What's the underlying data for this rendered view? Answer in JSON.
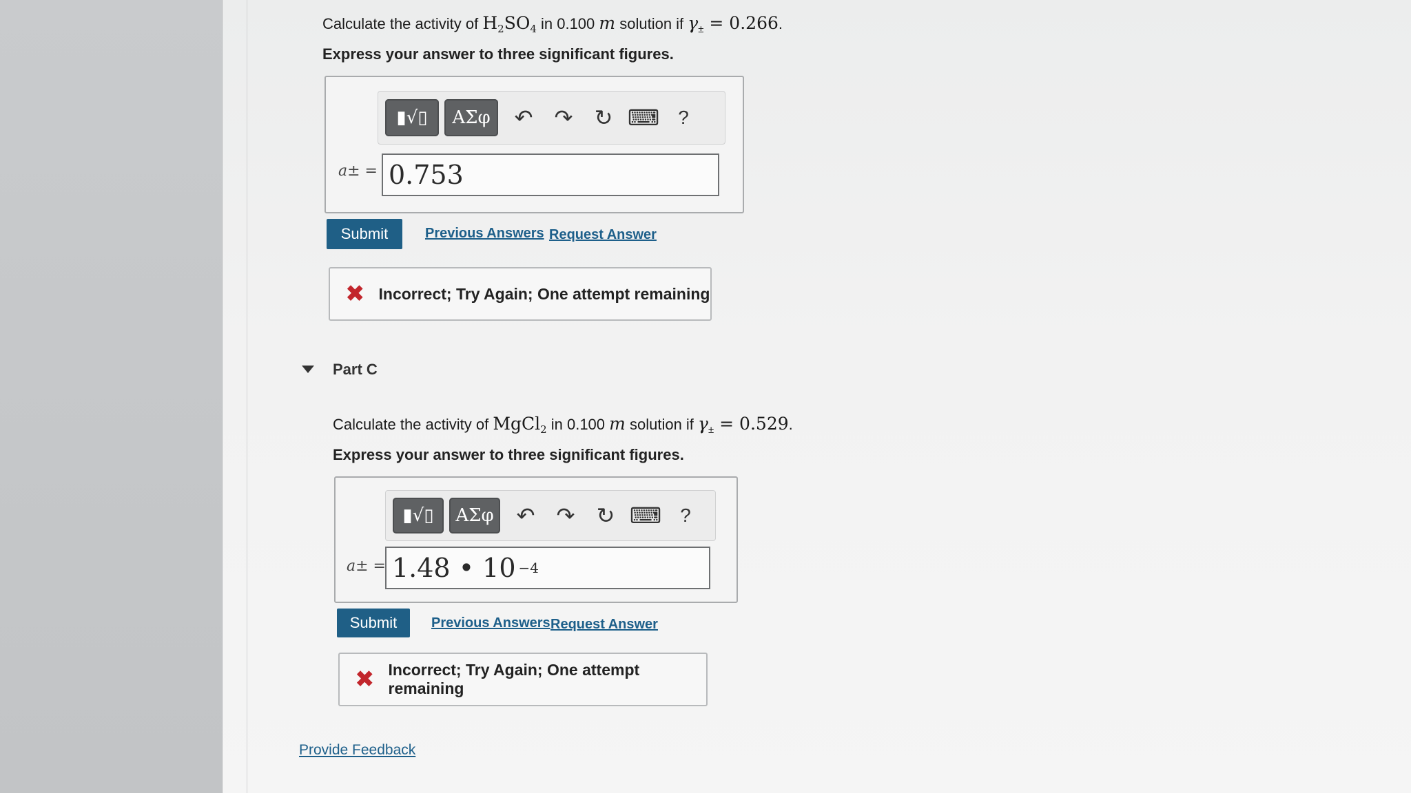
{
  "partB": {
    "question_prefix": "Calculate the activity of ",
    "compound_main": "H",
    "compound_sub1": "2",
    "compound_mid": "SO",
    "compound_sub2": "4",
    "question_mid": " in 0.100 ",
    "molality_unit": "m",
    "question_suffix": " solution if ",
    "gamma_symbol": "γ",
    "gamma_sub": "±",
    "gamma_value": " = 0.266",
    "trailing_period": ".",
    "instruction": "Express your answer to three significant figures.",
    "answer_label": "a± =",
    "answer_value": "0.753",
    "submit_label": "Submit",
    "previous_answers_label": "Previous Answers",
    "request_answer_label": "Request Answer",
    "feedback_icon": "✖",
    "feedback_text": "Incorrect; Try Again; One attempt remaining"
  },
  "partC": {
    "title": "Part C",
    "question_prefix": "Calculate the activity of ",
    "compound_main": "MgCl",
    "compound_sub": "2",
    "question_mid": " in 0.100 ",
    "molality_unit": "m",
    "question_suffix": " solution if ",
    "gamma_symbol": "γ",
    "gamma_sub": "±",
    "gamma_value": " = 0.529",
    "trailing_period": ".",
    "instruction": "Express your answer to three significant figures.",
    "answer_label": "a± =",
    "answer_value_mantissa": "1.48 • 10",
    "answer_value_exponent": "−4",
    "submit_label": "Submit",
    "previous_answers_label": "Previous Answers",
    "request_answer_label": "Request Answer",
    "feedback_icon": "✖",
    "feedback_text": "Incorrect; Try Again; One attempt remaining"
  },
  "toolbar": {
    "templates_label": "▮√▯",
    "symbols_label": "ΑΣφ",
    "undo_icon": "↶",
    "redo_icon": "↷",
    "reset_icon": "↻",
    "keyboard_icon": "⌨",
    "help_label": "?"
  },
  "footer": {
    "provide_feedback_label": "Provide Feedback"
  },
  "colors": {
    "submit_bg": "#1f5f86",
    "link": "#1d5f8a",
    "error_x": "#c2262c"
  }
}
